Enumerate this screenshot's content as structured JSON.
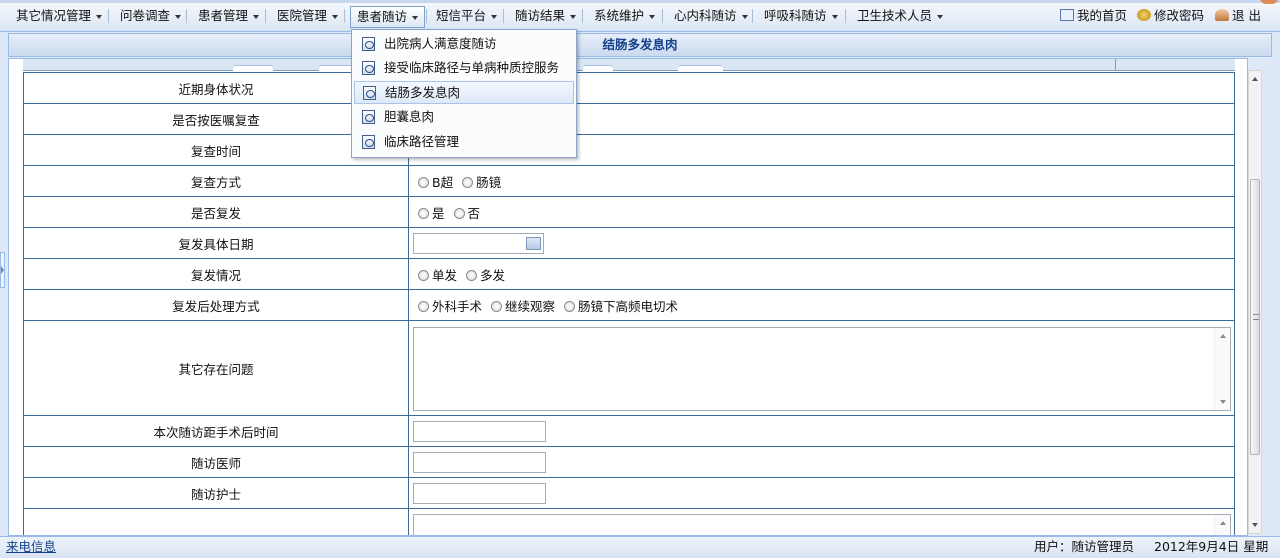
{
  "menubar": {
    "items": [
      {
        "label": "其它情况管理"
      },
      {
        "label": "问卷调查"
      },
      {
        "label": "患者管理"
      },
      {
        "label": "医院管理"
      },
      {
        "label": "患者随访"
      },
      {
        "label": "短信平台"
      },
      {
        "label": "随访结果"
      },
      {
        "label": "系统维护"
      },
      {
        "label": "心内科随访"
      },
      {
        "label": "呼吸科随访"
      },
      {
        "label": "卫生技术人员"
      }
    ],
    "right": {
      "home": "我的首页",
      "password": "修改密码",
      "logout": "退 出"
    }
  },
  "dropdown": {
    "items": [
      {
        "label": "出院病人满意度随访"
      },
      {
        "label": "接受临床路径与单病种质控服务"
      },
      {
        "label": "结肠多发息肉"
      },
      {
        "label": "胆囊息肉"
      },
      {
        "label": "临床路径管理"
      }
    ]
  },
  "panel": {
    "title": "结肠多发息肉"
  },
  "form": {
    "rows": [
      {
        "label": "近期身体状况"
      },
      {
        "label": "是否按医嘱复查"
      },
      {
        "label": "复查时间"
      },
      {
        "label": "复查方式",
        "options": [
          "B超",
          "肠镜"
        ]
      },
      {
        "label": "是否复发",
        "options": [
          "是",
          "否"
        ]
      },
      {
        "label": "复发具体日期"
      },
      {
        "label": "复发情况",
        "options": [
          "单发",
          "多发"
        ]
      },
      {
        "label": "复发后处理方式",
        "options": [
          "外科手术",
          "继续观察",
          "肠镜下高频电切术"
        ]
      },
      {
        "label": "其它存在问题"
      },
      {
        "label": "本次随访距手术后时间"
      },
      {
        "label": "随访医师"
      },
      {
        "label": "随访护士"
      }
    ]
  },
  "statusbar": {
    "link": "来电信息",
    "user": "用户：随访管理员",
    "date": "2012年9月4日  星期二"
  }
}
